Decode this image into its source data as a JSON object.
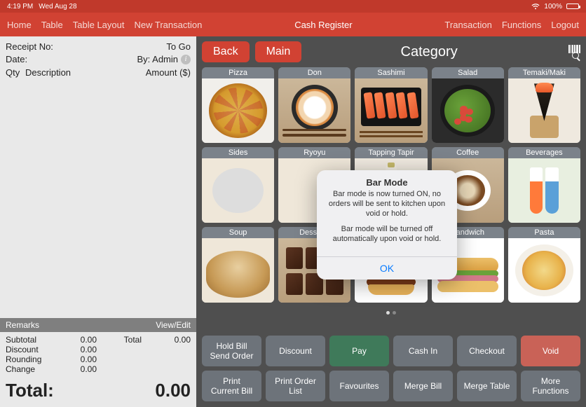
{
  "statusbar": {
    "time": "4:19 PM",
    "date": "Wed Aug 28",
    "battery": "100%"
  },
  "nav": {
    "left": [
      "Home",
      "Table",
      "Table Layout",
      "New Transaction"
    ],
    "center": "Cash Register",
    "right": [
      "Transaction",
      "Functions",
      "Logout"
    ]
  },
  "receipt": {
    "receipt_no_label": "Receipt No:",
    "to_go": "To Go",
    "date_label": "Date:",
    "by_label": "By: Admin",
    "cols": {
      "qty": "Qty",
      "desc": "Description",
      "amount": "Amount ($)"
    },
    "remarks": "Remarks",
    "view_edit": "View/Edit",
    "lines": {
      "subtotal_label": "Subtotal",
      "subtotal": "0.00",
      "discount_label": "Discount",
      "discount": "0.00",
      "rounding_label": "Rounding",
      "rounding": "0.00",
      "change_label": "Change",
      "change": "0.00",
      "total_side_label": "Total",
      "total_side": "0.00"
    },
    "grand_label": "Total:",
    "grand_value": "0.00"
  },
  "panel": {
    "back": "Back",
    "main": "Main",
    "category": "Category",
    "tiles": [
      "Pizza",
      "Don",
      "Sashimi",
      "Salad",
      "Temaki/Maki",
      "Sides",
      "Ryoyu",
      "Tapping Tapir",
      "Coffee",
      "Beverages",
      "Soup",
      "Desserts",
      "Burgers",
      "Sandwich",
      "Pasta"
    ]
  },
  "actions": {
    "row1": [
      "Hold Bill\nSend Order",
      "Discount",
      "Pay",
      "Cash In",
      "Checkout",
      "Void"
    ],
    "row2": [
      "Print\nCurrent Bill",
      "Print Order\nList",
      "Favourites",
      "Merge Bill",
      "Merge Table",
      "More\nFunctions"
    ]
  },
  "modal": {
    "title": "Bar Mode",
    "line1": "Bar mode is now turned ON, no orders will be sent to kitchen upon void or hold.",
    "line2": "Bar mode will be turned off automatically upon void or hold.",
    "ok": "OK"
  }
}
